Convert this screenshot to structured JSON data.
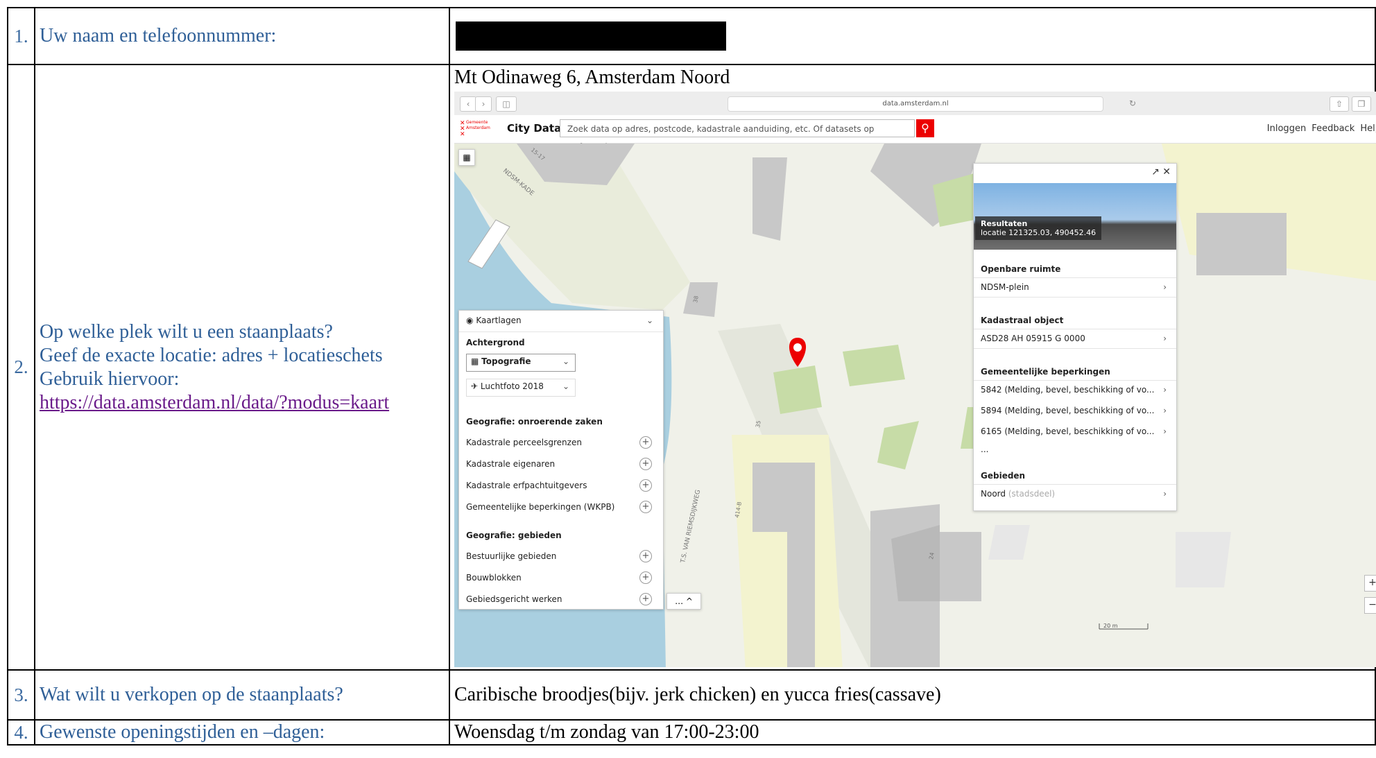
{
  "rows": [
    {
      "num": "1.",
      "question": "Uw naam en telefoonnummer:"
    },
    {
      "num": "2.",
      "question_lines": [
        "Op welke plek wilt u een staanplaats?",
        "Geef de exacte locatie: adres + locatieschets",
        "Gebruik hiervoor:"
      ],
      "link": "https://data.amsterdam.nl/data/?modus=kaart",
      "answer": "Mt Odinaweg 6, Amsterdam Noord"
    },
    {
      "num": "3.",
      "question": "Wat wilt u verkopen op de staanplaats?",
      "answer": "Caribische broodjes(bijv. jerk chicken) en yucca fries(cassave)"
    },
    {
      "num": "4.",
      "question": "Gewenste openingstijden en –dagen:",
      "answer": "Woensdag t/m zondag van 17:00-23:00"
    }
  ],
  "screenshot": {
    "url": "data.amsterdam.nl",
    "logo_lines": [
      "Gemeente",
      "Amsterdam"
    ],
    "app_name": "City Data",
    "search_placeholder": "Zoek data op adres, postcode, kadastrale aanduiding, etc. Of datasets op trefwoord",
    "header_links": "Inloggen Feedback Help",
    "map_labels": {
      "kade": "NDSM-KADE",
      "weg": "T.S. VAN RIEMSDIJKWEG",
      "n1": "15-17",
      "n2": "35",
      "n3": "414-B",
      "n4": "24",
      "n5": "38"
    },
    "scale": "20 m",
    "layers": {
      "title": "Kaartlagen",
      "background_heading": "Achtergrond",
      "bg_primary": "Topografie",
      "bg_secondary": "Luchtfoto 2018",
      "section1": "Geografie: onroerende zaken",
      "items1": [
        "Kadastrale perceelsgrenzen",
        "Kadastrale eigenaren",
        "Kadastrale erfpachtuitgevers",
        "Gemeentelijke beperkingen (WKPB)"
      ],
      "section2": "Geografie: gebieden",
      "items2": [
        "Bestuurlijke gebieden",
        "Bouwblokken",
        "Gebiedsgericht werken"
      ],
      "more": "… ^"
    },
    "results": {
      "photo_title": "Resultaten",
      "photo_location": "locatie 121325.03, 490452.46",
      "h1": "Openbare ruimte",
      "v1": "NDSM-plein",
      "h2": "Kadastraal object",
      "v2": "ASD28 AH 05915 G 0000",
      "h3": "Gemeentelijke beperkingen",
      "b1": "5842 (Melding, bevel, beschikking of vo...",
      "b2": "5894 (Melding, bevel, beschikking of vo...",
      "b3": "6165 (Melding, bevel, beschikking of vo...",
      "ellipsis": "...",
      "h4": "Gebieden",
      "v4": "Noord",
      "v4b": "(stadsdeel)"
    },
    "colors": {
      "brand": "#ec0000",
      "water": "#a9cfe0",
      "green": "#c7dca7",
      "building": "#c8c8c8"
    }
  }
}
